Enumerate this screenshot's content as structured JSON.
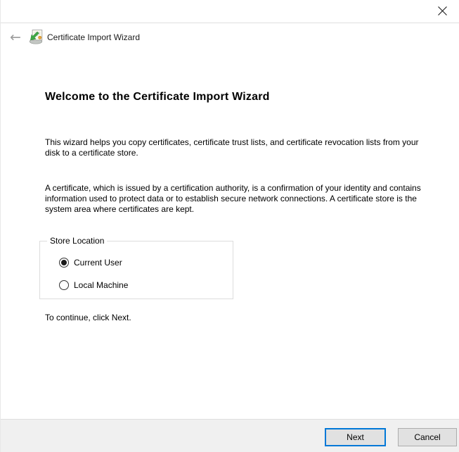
{
  "window": {
    "icons": {
      "close": "close-x",
      "back": "←",
      "app": "certificate-import"
    }
  },
  "header": {
    "title": "Certificate Import Wizard"
  },
  "content": {
    "heading": "Welcome to the Certificate Import Wizard",
    "paragraph1": "This wizard helps you copy certificates, certificate trust lists, and certificate revocation lists from your disk to a certificate store.",
    "paragraph2": "A certificate, which is issued by a certification authority, is a confirmation of your identity and contains information used to protect data or to establish secure network connections. A certificate store is the system area where certificates are kept.",
    "store_location": {
      "label": "Store Location",
      "options": [
        {
          "label": "Current User",
          "selected": true
        },
        {
          "label": "Local Machine",
          "selected": false
        }
      ]
    },
    "continue_text": "To continue, click Next."
  },
  "footer": {
    "next_label": "Next",
    "cancel_label": "Cancel"
  },
  "colors": {
    "accent": "#0078D7",
    "footer_bg": "#F0F0F0",
    "button_bg": "#E1E1E1",
    "button_border": "#ADADAD",
    "separator": "#DFDFDF",
    "icon_green": "#3FA845",
    "icon_gold": "#E8A33D"
  }
}
